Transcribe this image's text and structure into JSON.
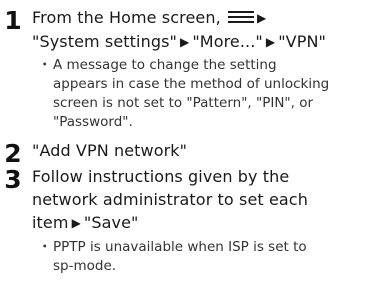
{
  "steps": [
    {
      "number": "1",
      "lines": [
        {
          "before_icon": "From the Home screen, ",
          "after_icon_arrow": "▶"
        },
        {
          "parts": [
            "\"System settings\"",
            "▶",
            "\"More...\"",
            "▶",
            "\"VPN\""
          ]
        }
      ],
      "icon": "menu-icon",
      "note_bullet": "・",
      "note_lines": [
        "A message to change the setting",
        "appears in case the method of unlocking",
        "screen is not set to \"Pattern\", \"PIN\", or",
        "\"Password\"."
      ]
    },
    {
      "number": "2",
      "lines": [
        {
          "text": "\"Add VPN network\""
        }
      ]
    },
    {
      "number": "3",
      "lines": [
        {
          "text": "Follow instructions given by the"
        },
        {
          "text": "network administrator to set each"
        },
        {
          "parts": [
            "item",
            "▶",
            "\"Save\""
          ]
        }
      ],
      "note_bullet": "・",
      "note_lines": [
        "PPTP is unavailable when ISP is set to",
        "sp-mode."
      ]
    }
  ]
}
